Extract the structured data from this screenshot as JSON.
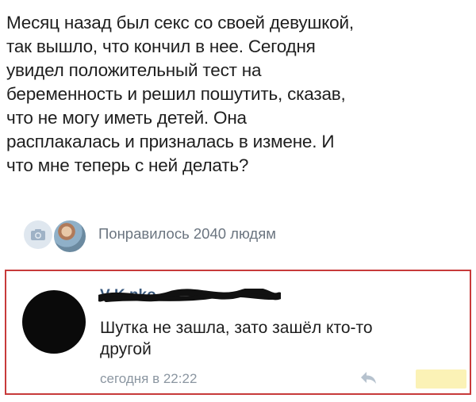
{
  "post": {
    "lines": [
      "Месяц назад был секс со своей девушкой,",
      "так вышло, что кончил в нее. Сегодня",
      "увидел положительный тест на",
      "беременность и решил пошутить, сказав,",
      "что не могу иметь детей. Она",
      "расплакалась и призналась в измене. И",
      "что мне теперь с ней делать?"
    ]
  },
  "likes": {
    "text": "Понравилось 2040 людям",
    "icons": [
      "camera-icon",
      "avatar-photo"
    ]
  },
  "comment": {
    "author": "V           K          nko",
    "lines": [
      "Шутка не зашла, зато зашёл кто-то",
      "другой"
    ],
    "timestamp": "сегодня в 22:22",
    "highlight_color": "#c73a3a",
    "reply_icon": "reply-arrow-icon"
  }
}
